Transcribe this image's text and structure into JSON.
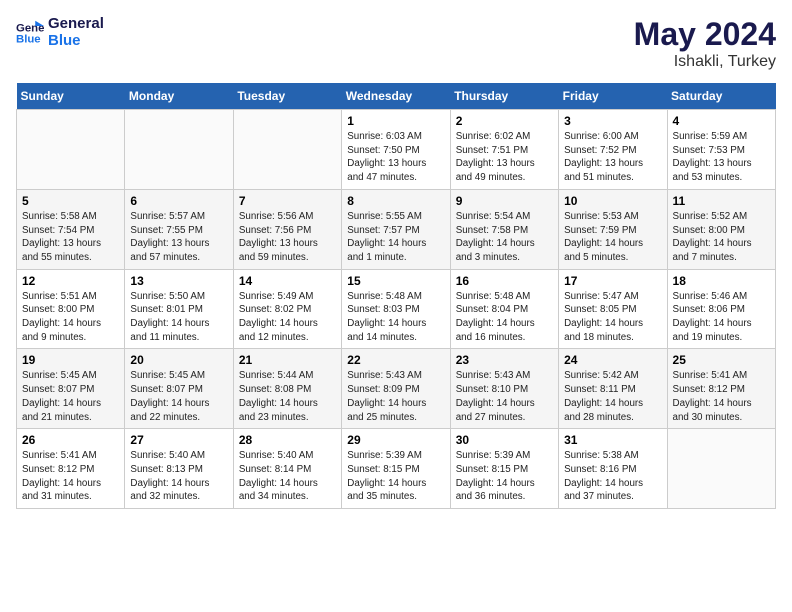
{
  "logo": {
    "line1": "General",
    "line2": "Blue"
  },
  "title": "May 2024",
  "subtitle": "Ishakli, Turkey",
  "days_header": [
    "Sunday",
    "Monday",
    "Tuesday",
    "Wednesday",
    "Thursday",
    "Friday",
    "Saturday"
  ],
  "weeks": [
    [
      {
        "day": "",
        "info": ""
      },
      {
        "day": "",
        "info": ""
      },
      {
        "day": "",
        "info": ""
      },
      {
        "day": "1",
        "info": "Sunrise: 6:03 AM\nSunset: 7:50 PM\nDaylight: 13 hours\nand 47 minutes."
      },
      {
        "day": "2",
        "info": "Sunrise: 6:02 AM\nSunset: 7:51 PM\nDaylight: 13 hours\nand 49 minutes."
      },
      {
        "day": "3",
        "info": "Sunrise: 6:00 AM\nSunset: 7:52 PM\nDaylight: 13 hours\nand 51 minutes."
      },
      {
        "day": "4",
        "info": "Sunrise: 5:59 AM\nSunset: 7:53 PM\nDaylight: 13 hours\nand 53 minutes."
      }
    ],
    [
      {
        "day": "5",
        "info": "Sunrise: 5:58 AM\nSunset: 7:54 PM\nDaylight: 13 hours\nand 55 minutes."
      },
      {
        "day": "6",
        "info": "Sunrise: 5:57 AM\nSunset: 7:55 PM\nDaylight: 13 hours\nand 57 minutes."
      },
      {
        "day": "7",
        "info": "Sunrise: 5:56 AM\nSunset: 7:56 PM\nDaylight: 13 hours\nand 59 minutes."
      },
      {
        "day": "8",
        "info": "Sunrise: 5:55 AM\nSunset: 7:57 PM\nDaylight: 14 hours\nand 1 minute."
      },
      {
        "day": "9",
        "info": "Sunrise: 5:54 AM\nSunset: 7:58 PM\nDaylight: 14 hours\nand 3 minutes."
      },
      {
        "day": "10",
        "info": "Sunrise: 5:53 AM\nSunset: 7:59 PM\nDaylight: 14 hours\nand 5 minutes."
      },
      {
        "day": "11",
        "info": "Sunrise: 5:52 AM\nSunset: 8:00 PM\nDaylight: 14 hours\nand 7 minutes."
      }
    ],
    [
      {
        "day": "12",
        "info": "Sunrise: 5:51 AM\nSunset: 8:00 PM\nDaylight: 14 hours\nand 9 minutes."
      },
      {
        "day": "13",
        "info": "Sunrise: 5:50 AM\nSunset: 8:01 PM\nDaylight: 14 hours\nand 11 minutes."
      },
      {
        "day": "14",
        "info": "Sunrise: 5:49 AM\nSunset: 8:02 PM\nDaylight: 14 hours\nand 12 minutes."
      },
      {
        "day": "15",
        "info": "Sunrise: 5:48 AM\nSunset: 8:03 PM\nDaylight: 14 hours\nand 14 minutes."
      },
      {
        "day": "16",
        "info": "Sunrise: 5:48 AM\nSunset: 8:04 PM\nDaylight: 14 hours\nand 16 minutes."
      },
      {
        "day": "17",
        "info": "Sunrise: 5:47 AM\nSunset: 8:05 PM\nDaylight: 14 hours\nand 18 minutes."
      },
      {
        "day": "18",
        "info": "Sunrise: 5:46 AM\nSunset: 8:06 PM\nDaylight: 14 hours\nand 19 minutes."
      }
    ],
    [
      {
        "day": "19",
        "info": "Sunrise: 5:45 AM\nSunset: 8:07 PM\nDaylight: 14 hours\nand 21 minutes."
      },
      {
        "day": "20",
        "info": "Sunrise: 5:45 AM\nSunset: 8:07 PM\nDaylight: 14 hours\nand 22 minutes."
      },
      {
        "day": "21",
        "info": "Sunrise: 5:44 AM\nSunset: 8:08 PM\nDaylight: 14 hours\nand 23 minutes."
      },
      {
        "day": "22",
        "info": "Sunrise: 5:43 AM\nSunset: 8:09 PM\nDaylight: 14 hours\nand 25 minutes."
      },
      {
        "day": "23",
        "info": "Sunrise: 5:43 AM\nSunset: 8:10 PM\nDaylight: 14 hours\nand 27 minutes."
      },
      {
        "day": "24",
        "info": "Sunrise: 5:42 AM\nSunset: 8:11 PM\nDaylight: 14 hours\nand 28 minutes."
      },
      {
        "day": "25",
        "info": "Sunrise: 5:41 AM\nSunset: 8:12 PM\nDaylight: 14 hours\nand 30 minutes."
      }
    ],
    [
      {
        "day": "26",
        "info": "Sunrise: 5:41 AM\nSunset: 8:12 PM\nDaylight: 14 hours\nand 31 minutes."
      },
      {
        "day": "27",
        "info": "Sunrise: 5:40 AM\nSunset: 8:13 PM\nDaylight: 14 hours\nand 32 minutes."
      },
      {
        "day": "28",
        "info": "Sunrise: 5:40 AM\nSunset: 8:14 PM\nDaylight: 14 hours\nand 34 minutes."
      },
      {
        "day": "29",
        "info": "Sunrise: 5:39 AM\nSunset: 8:15 PM\nDaylight: 14 hours\nand 35 minutes."
      },
      {
        "day": "30",
        "info": "Sunrise: 5:39 AM\nSunset: 8:15 PM\nDaylight: 14 hours\nand 36 minutes."
      },
      {
        "day": "31",
        "info": "Sunrise: 5:38 AM\nSunset: 8:16 PM\nDaylight: 14 hours\nand 37 minutes."
      },
      {
        "day": "",
        "info": ""
      }
    ]
  ]
}
